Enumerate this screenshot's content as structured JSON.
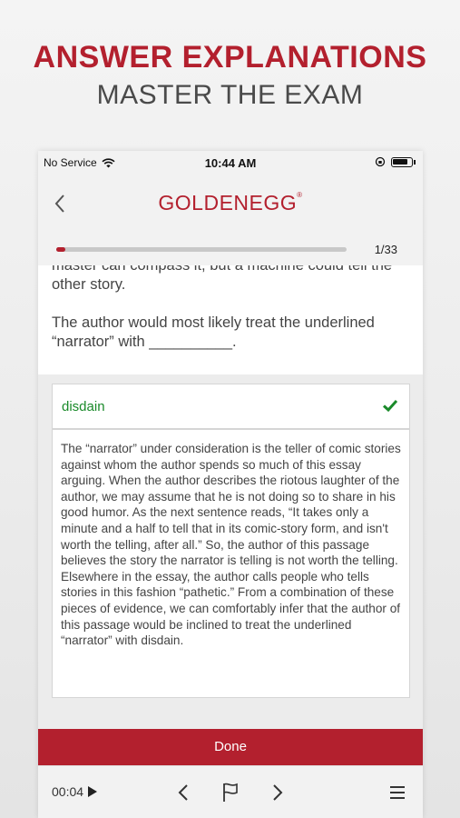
{
  "promo": {
    "title": "ANSWER EXPLANATIONS",
    "subtitle": "MASTER THE EXAM"
  },
  "status_bar": {
    "carrier": "No Service",
    "time": "10:44 AM"
  },
  "header": {
    "logo_text": "GOLDENEGG",
    "logo_mark": "®"
  },
  "progress": {
    "fraction": 0.03,
    "label": "1/33"
  },
  "question": {
    "passage_tail": "master can compass it, but a machine could tell the other story.",
    "prompt": "The author would most likely treat the underlined “narrator” with __________."
  },
  "answer": {
    "selected": "disdain",
    "status": "correct",
    "explanation": "The “narrator” under consideration is the teller of comic stories against whom the author spends so much of this essay arguing. When the author describes the riotous laughter of the author, we may assume that he is not doing so to share in his good humor. As the next sentence reads, “It takes only a minute and a half to tell that in its comic-story form, and isn't worth the telling, after all.” So, the author of this passage believes the story the narrator is telling is not worth the telling. Elsewhere in the essay, the author calls people who tells stories in this fashion “pathetic.” From a combination of these pieces of evidence, we can comfortably infer that the author of this passage would be inclined to treat the underlined “narrator” with disdain."
  },
  "done_label": "Done",
  "toolbar": {
    "timer": "00:04",
    "icons": [
      "play-icon",
      "previous-icon",
      "flag-icon",
      "next-icon",
      "menu-icon"
    ]
  },
  "colors": {
    "brand_red": "#b3202e",
    "correct_green": "#1a8a2a"
  }
}
